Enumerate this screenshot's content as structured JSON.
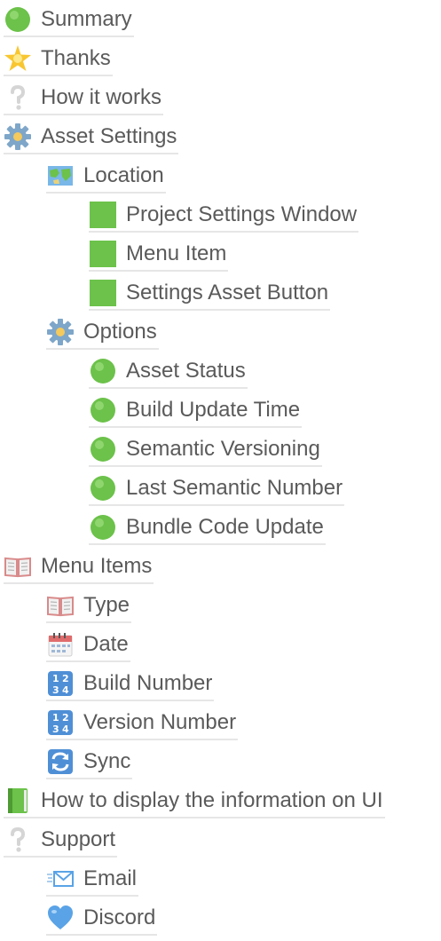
{
  "toc": {
    "items": [
      {
        "label": "Summary",
        "icon": "green-circle-icon"
      },
      {
        "label": "Thanks",
        "icon": "star-icon"
      },
      {
        "label": "How it works",
        "icon": "question-mark-icon"
      },
      {
        "label": "Asset Settings",
        "icon": "gear-icon"
      },
      {
        "label": "Location",
        "icon": "map-icon"
      },
      {
        "label": "Project Settings Window",
        "icon": "green-square-icon"
      },
      {
        "label": "Menu Item",
        "icon": "green-square-icon"
      },
      {
        "label": "Settings Asset Button",
        "icon": "green-square-icon"
      },
      {
        "label": "Options",
        "icon": "gear-icon"
      },
      {
        "label": "Asset Status",
        "icon": "green-circle-icon"
      },
      {
        "label": "Build Update Time",
        "icon": "green-circle-icon"
      },
      {
        "label": "Semantic Versioning",
        "icon": "green-circle-icon"
      },
      {
        "label": "Last Semantic Number",
        "icon": "green-circle-icon"
      },
      {
        "label": "Bundle Code Update",
        "icon": "green-circle-icon"
      },
      {
        "label": "Menu Items",
        "icon": "open-book-icon"
      },
      {
        "label": "Type",
        "icon": "open-book-icon"
      },
      {
        "label": "Date",
        "icon": "calendar-icon"
      },
      {
        "label": "Build Number",
        "icon": "numbers-icon"
      },
      {
        "label": "Version Number",
        "icon": "numbers-icon"
      },
      {
        "label": "Sync",
        "icon": "sync-icon"
      },
      {
        "label": "How to display the information on UI",
        "icon": "green-book-icon"
      },
      {
        "label": "Support",
        "icon": "question-mark-icon"
      },
      {
        "label": "Email",
        "icon": "envelope-icon"
      },
      {
        "label": "Discord",
        "icon": "blue-heart-icon"
      }
    ]
  },
  "colors": {
    "link_text": "#5a5a5a",
    "underline": "#e6e6e6",
    "green": "#6cc24a",
    "blue_heart": "#5aa3e6"
  }
}
